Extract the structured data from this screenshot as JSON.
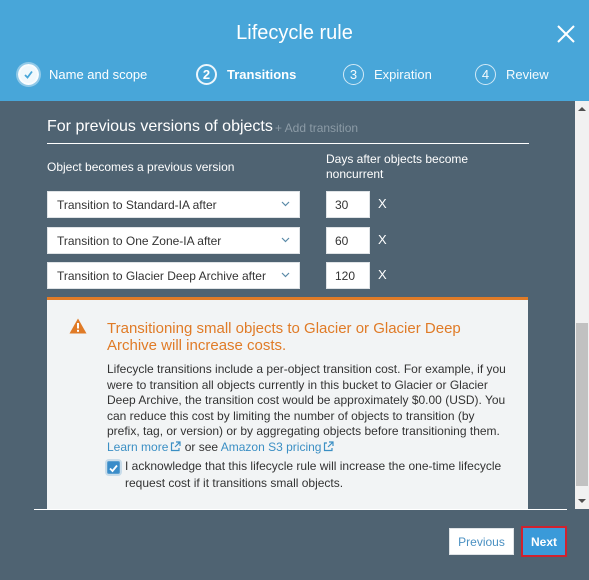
{
  "header": {
    "title": "Lifecycle rule",
    "steps": [
      {
        "number": "✓",
        "label": "Name and scope",
        "state": "completed"
      },
      {
        "number": "2",
        "label": "Transitions",
        "state": "active"
      },
      {
        "number": "3",
        "label": "Expiration",
        "state": "upcoming"
      },
      {
        "number": "4",
        "label": "Review",
        "state": "upcoming"
      }
    ]
  },
  "section": {
    "title": "For previous versions of objects",
    "add_transition": "+ Add transition",
    "col1_label": "Object becomes a previous version",
    "col2_label": "Days after objects become noncurrent"
  },
  "transitions": [
    {
      "storage_class": "Transition to Standard-IA after",
      "days": "30",
      "remove": "X"
    },
    {
      "storage_class": "Transition to One Zone-IA after",
      "days": "60",
      "remove": "X"
    },
    {
      "storage_class": "Transition to Glacier Deep Archive after",
      "days": "120",
      "remove": "X"
    }
  ],
  "warning": {
    "title": "Transitioning small objects to Glacier or Glacier Deep Archive will increase costs.",
    "body": "Lifecycle transitions include a per-object transition cost. For example, if you were to transition all objects currently in this bucket to Glacier or Glacier Deep Archive, the transition cost would be approximately $0.00 (USD). You can reduce this cost by limiting the number of objects to transition (by prefix, tag, or version) or by aggregating objects before transitioning them. ",
    "learn_more": "Learn more",
    "or_see": " or see ",
    "pricing_link": "Amazon S3 pricing",
    "acknowledge": "I acknowledge that this lifecycle rule will increase the one-time lifecycle request cost if it transitions small objects.",
    "acknowledged": true
  },
  "footer": {
    "previous": "Previous",
    "next": "Next"
  },
  "colors": {
    "header_bg": "#48a6d9",
    "body_bg": "#4f6372",
    "warning_accent": "#e07b27",
    "link": "#3b8fc4",
    "primary_button": "#3a9ad9",
    "highlight_border": "#d0222e"
  }
}
